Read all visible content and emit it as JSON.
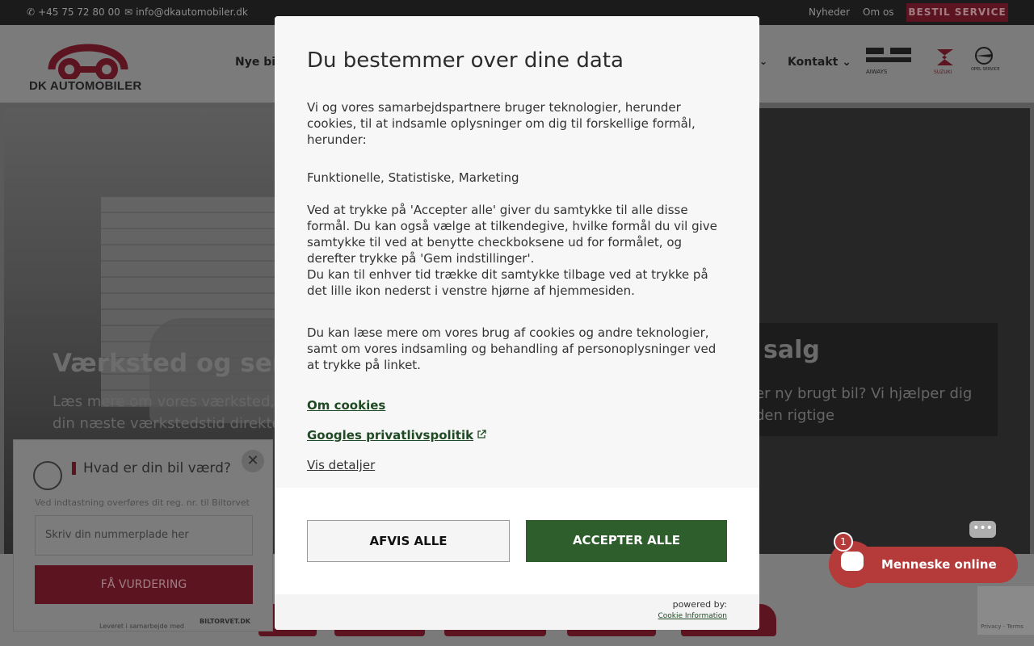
{
  "topbar": {
    "phone": "+45 75 72 80 00",
    "email": "info@dkautomobiler.dk",
    "links": [
      "Nyheder",
      "Om os"
    ],
    "service_button": "BESTIL SERVICE"
  },
  "header": {
    "logo_text": "DK AUTOMOBILER",
    "nav_new": "Nye bil",
    "nav_contact": "Kontakt",
    "nav_chevron": "⌄",
    "brands": [
      "AIWAYS",
      "SUZUKI",
      "OPEL SERVICE"
    ]
  },
  "hero": {
    "workshop_title": "Værksted og servic",
    "workshop_text_1": "Læs mere om vores værksted, og",
    "workshop_text_2": "din næste værkstedstid direkte fr",
    "sale_title": "salg",
    "sale_text_1": "er ny brugt bil? Vi hjælper dig",
    "sale_text_2": "den rigtige"
  },
  "valuation_widget": {
    "title": "Hvad er din bil værd?",
    "note": "Ved indtastning overføres dit reg. nr. til Biltorvet",
    "input_placeholder": "Skriv din nummerplade her",
    "button": "FÅ VURDERING",
    "footer": "Leveret i samarbejde med",
    "partner": "BILTORVET.DK",
    "close_glyph": "✕"
  },
  "chat": {
    "label": "Menneske online",
    "badge": "1",
    "dots": "•••"
  },
  "recaptcha": {
    "text": "Privacy - Terms"
  },
  "consent_modal": {
    "title": "Du bestemmer over dine data",
    "intro": "Vi og vores samarbejdspartnere bruger teknologier, herunder cookies, til at indsamle oplysninger om dig til forskellige formål, herunder:",
    "purposes": "Funktionelle, Statistiske, Marketing",
    "explanation_1": "Ved at trykke på 'Accepter alle' giver du samtykke til alle disse formål. Du kan også vælge at tilkendegive, hvilke formål du vil give samtykke til ved at benytte checkboksene ud for formålet, og derefter trykke på 'Gem indstillinger'.",
    "explanation_2": "Du kan til enhver tid trække dit samtykke tilbage ved at trykke på det lille ikon nederst i venstre hjørne af hjemmesiden.",
    "read_more": "Du kan læse mere om vores brug af cookies og andre teknologier, samt om vores indsamling og behandling af personoplysninger ved at trykke på linket.",
    "link_cookies": "Om cookies",
    "link_google": "Googles privatlivspolitik",
    "link_details": "Vis detaljer",
    "decline_button": "AFVIS ALLE",
    "accept_button": "ACCEPTER ALLE",
    "powered_by": "powered by:",
    "provider": "Cookie Information",
    "accent_color": "#2e5e2c"
  }
}
